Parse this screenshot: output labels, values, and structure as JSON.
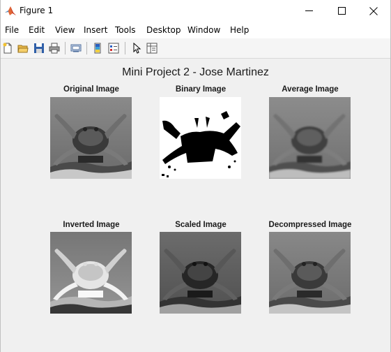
{
  "window": {
    "title": "Figure 1",
    "icons": [
      "matlab-logo-icon",
      "minimize-icon",
      "maximize-icon",
      "close-icon"
    ]
  },
  "menu": [
    "File",
    "Edit",
    "View",
    "Insert",
    "Tools",
    "Desktop",
    "Window",
    "Help"
  ],
  "toolbar": [
    "new-figure-icon",
    "open-file-icon",
    "save-icon",
    "print-icon",
    "link-plot-icon",
    "insert-colorbar-icon",
    "insert-legend-icon",
    "edit-plot-icon",
    "property-inspector-icon"
  ],
  "figure": {
    "title": "Mini Project 2 - Jose Martinez",
    "subplots": [
      {
        "title": "Original Image"
      },
      {
        "title": "Binary Image"
      },
      {
        "title": "Average Image"
      },
      {
        "title": "Inverted Image"
      },
      {
        "title": "Scaled Image"
      },
      {
        "title": "Decompressed Image"
      }
    ]
  },
  "colors": {
    "titlebar": "#ffffff",
    "figure_bg": "#f0f0f0",
    "matlab_orange": "#e16737",
    "matlab_red": "#c3301d"
  }
}
